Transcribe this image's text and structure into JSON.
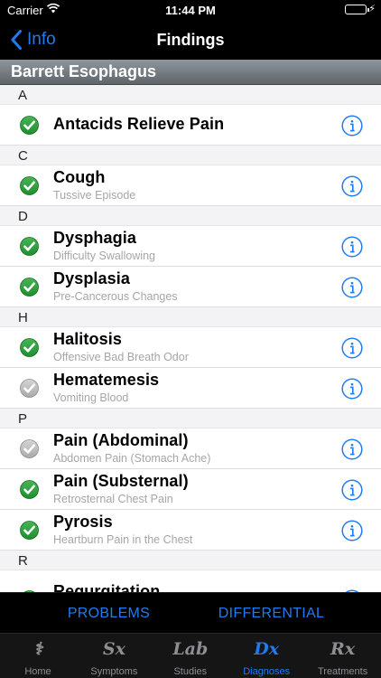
{
  "status": {
    "carrier": "Carrier",
    "time": "11:44 PM"
  },
  "nav": {
    "back_label": "Info",
    "title": "Findings"
  },
  "disease_title": "Barrett Esophagus",
  "sections": [
    {
      "letter": "A",
      "items": [
        {
          "title": "Antacids Relieve Pain",
          "subtitle": "",
          "checked": true
        }
      ]
    },
    {
      "letter": "C",
      "items": [
        {
          "title": "Cough",
          "subtitle": "Tussive Episode",
          "checked": true
        }
      ]
    },
    {
      "letter": "D",
      "items": [
        {
          "title": "Dysphagia",
          "subtitle": "Difficulty Swallowing",
          "checked": true
        },
        {
          "title": "Dysplasia",
          "subtitle": "Pre-Cancerous Changes",
          "checked": true
        }
      ]
    },
    {
      "letter": "H",
      "items": [
        {
          "title": "Halitosis",
          "subtitle": "Offensive Bad Breath Odor",
          "checked": true
        },
        {
          "title": "Hematemesis",
          "subtitle": "Vomiting Blood",
          "checked": false
        }
      ]
    },
    {
      "letter": "P",
      "items": [
        {
          "title": "Pain (Abdominal)",
          "subtitle": "Abdomen Pain (Stomach Ache)",
          "checked": false
        },
        {
          "title": "Pain (Substernal)",
          "subtitle": "Retrosternal Chest Pain",
          "checked": true
        },
        {
          "title": "Pyrosis",
          "subtitle": "Heartburn Pain in the Chest",
          "checked": true
        }
      ]
    },
    {
      "letter": "R",
      "items": [
        {
          "title": "Regurgitation",
          "subtitle": "",
          "checked": true
        }
      ]
    }
  ],
  "segments": {
    "problems": "PROBLEMS",
    "differential": "DIFFERENTIAL"
  },
  "tabs": [
    {
      "id": "home",
      "label": "Home",
      "icon": "caduceus-icon",
      "glyph": "⚕",
      "active": false
    },
    {
      "id": "symptoms",
      "label": "Symptoms",
      "icon": "sx-icon",
      "glyph": "Sx",
      "active": false
    },
    {
      "id": "studies",
      "label": "Studies",
      "icon": "lab-icon",
      "glyph": "Lab",
      "active": false
    },
    {
      "id": "diagnoses",
      "label": "Diagnoses",
      "icon": "dx-icon",
      "glyph": "Dx",
      "active": true
    },
    {
      "id": "treatments",
      "label": "Treatments",
      "icon": "rx-icon",
      "glyph": "Rx",
      "active": false
    }
  ],
  "colors": {
    "accent": "#1e7cf2",
    "check_green": "#1d8f2e",
    "check_gray": "#a9a9a9",
    "tab_inactive": "#8e8e93"
  }
}
